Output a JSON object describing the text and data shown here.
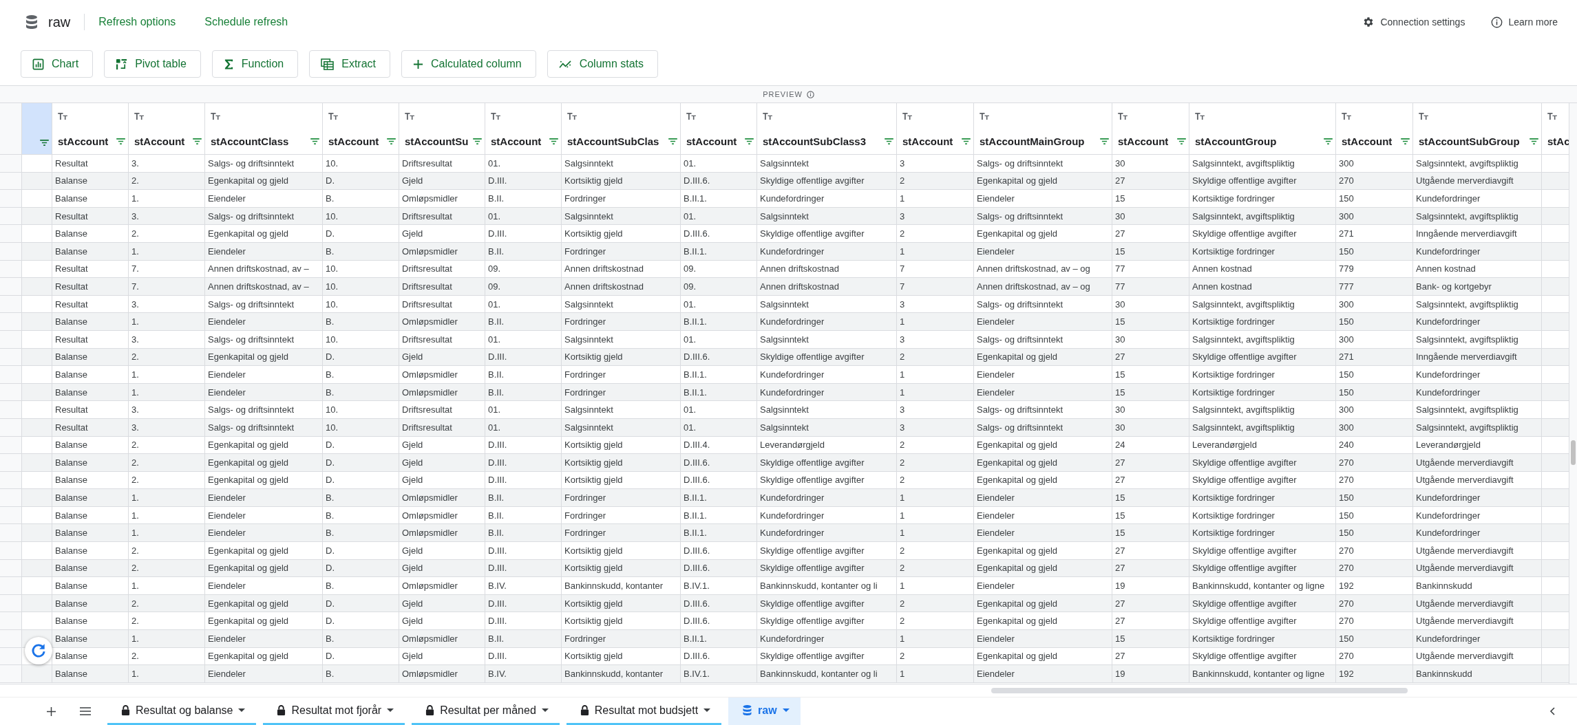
{
  "source": {
    "name": "raw"
  },
  "top_links": [
    "Refresh options",
    "Schedule refresh"
  ],
  "top_actions": [
    {
      "label": "Connection settings",
      "kind": "settings"
    },
    {
      "label": "Learn more",
      "kind": "info"
    }
  ],
  "toolbar": [
    {
      "label": "Chart",
      "kind": "chart"
    },
    {
      "label": "Pivot table",
      "kind": "pivot"
    },
    {
      "label": "Function",
      "kind": "function"
    },
    {
      "label": "Extract",
      "kind": "extract"
    },
    {
      "label": "Calculated column",
      "kind": "add"
    },
    {
      "label": "Column stats",
      "kind": "stats"
    }
  ],
  "preview_label": "PREVIEW",
  "table": {
    "columns": [
      "stAccount",
      "stAccount",
      "stAccountClass",
      "stAccount",
      "stAccountSu",
      "stAccount",
      "stAccountSubClas",
      "stAccount",
      "stAccountSubClass3",
      "stAccount",
      "stAccountMainGroup",
      "stAccount",
      "stAccountGroup",
      "stAccount",
      "stAccountSubGroup",
      "stAc"
    ],
    "rows": [
      [
        "Resultat",
        "3.",
        "Salgs- og driftsinntekt",
        "10.",
        "Driftsresultat",
        "01.",
        "Salgsinntekt",
        "01.",
        "Salgsinntekt",
        "3",
        "Salgs- og driftsinntekt",
        "30",
        "Salgsinntekt, avgiftspliktig",
        "300",
        "Salgsinntekt, avgiftspliktig"
      ],
      [
        "Balanse",
        "2.",
        "Egenkapital og gjeld",
        "D.",
        "Gjeld",
        "D.III.",
        "Kortsiktig gjeld",
        "D.III.6.",
        "Skyldige offentlige avgifter",
        "2",
        "Egenkapital og gjeld",
        "27",
        "Skyldige offentlige avgifter",
        "270",
        "Utgående merverdiavgift"
      ],
      [
        "Balanse",
        "1.",
        "Eiendeler",
        "B.",
        "Omløpsmidler",
        "B.II.",
        "Fordringer",
        "B.II.1.",
        "Kundefordringer",
        "1",
        "Eiendeler",
        "15",
        "Kortsiktige fordringer",
        "150",
        "Kundefordringer"
      ],
      [
        "Resultat",
        "3.",
        "Salgs- og driftsinntekt",
        "10.",
        "Driftsresultat",
        "01.",
        "Salgsinntekt",
        "01.",
        "Salgsinntekt",
        "3",
        "Salgs- og driftsinntekt",
        "30",
        "Salgsinntekt, avgiftspliktig",
        "300",
        "Salgsinntekt, avgiftspliktig"
      ],
      [
        "Balanse",
        "2.",
        "Egenkapital og gjeld",
        "D.",
        "Gjeld",
        "D.III.",
        "Kortsiktig gjeld",
        "D.III.6.",
        "Skyldige offentlige avgifter",
        "2",
        "Egenkapital og gjeld",
        "27",
        "Skyldige offentlige avgifter",
        "271",
        "Inngående merverdiavgift"
      ],
      [
        "Balanse",
        "1.",
        "Eiendeler",
        "B.",
        "Omløpsmidler",
        "B.II.",
        "Fordringer",
        "B.II.1.",
        "Kundefordringer",
        "1",
        "Eiendeler",
        "15",
        "Kortsiktige fordringer",
        "150",
        "Kundefordringer"
      ],
      [
        "Resultat",
        "7.",
        "Annen driftskostnad, av –",
        "10.",
        "Driftsresultat",
        "09.",
        "Annen driftskostnad",
        "09.",
        "Annen driftskostnad",
        "7",
        "Annen driftskostnad, av – og",
        "77",
        "Annen kostnad",
        "779",
        "Annen kostnad"
      ],
      [
        "Resultat",
        "7.",
        "Annen driftskostnad, av –",
        "10.",
        "Driftsresultat",
        "09.",
        "Annen driftskostnad",
        "09.",
        "Annen driftskostnad",
        "7",
        "Annen driftskostnad, av – og",
        "77",
        "Annen kostnad",
        "777",
        "Bank- og kortgebyr"
      ],
      [
        "Resultat",
        "3.",
        "Salgs- og driftsinntekt",
        "10.",
        "Driftsresultat",
        "01.",
        "Salgsinntekt",
        "01.",
        "Salgsinntekt",
        "3",
        "Salgs- og driftsinntekt",
        "30",
        "Salgsinntekt, avgiftspliktig",
        "300",
        "Salgsinntekt, avgiftspliktig"
      ],
      [
        "Balanse",
        "1.",
        "Eiendeler",
        "B.",
        "Omløpsmidler",
        "B.II.",
        "Fordringer",
        "B.II.1.",
        "Kundefordringer",
        "1",
        "Eiendeler",
        "15",
        "Kortsiktige fordringer",
        "150",
        "Kundefordringer"
      ],
      [
        "Resultat",
        "3.",
        "Salgs- og driftsinntekt",
        "10.",
        "Driftsresultat",
        "01.",
        "Salgsinntekt",
        "01.",
        "Salgsinntekt",
        "3",
        "Salgs- og driftsinntekt",
        "30",
        "Salgsinntekt, avgiftspliktig",
        "300",
        "Salgsinntekt, avgiftspliktig"
      ],
      [
        "Balanse",
        "2.",
        "Egenkapital og gjeld",
        "D.",
        "Gjeld",
        "D.III.",
        "Kortsiktig gjeld",
        "D.III.6.",
        "Skyldige offentlige avgifter",
        "2",
        "Egenkapital og gjeld",
        "27",
        "Skyldige offentlige avgifter",
        "271",
        "Inngående merverdiavgift"
      ],
      [
        "Balanse",
        "1.",
        "Eiendeler",
        "B.",
        "Omløpsmidler",
        "B.II.",
        "Fordringer",
        "B.II.1.",
        "Kundefordringer",
        "1",
        "Eiendeler",
        "15",
        "Kortsiktige fordringer",
        "150",
        "Kundefordringer"
      ],
      [
        "Balanse",
        "1.",
        "Eiendeler",
        "B.",
        "Omløpsmidler",
        "B.II.",
        "Fordringer",
        "B.II.1.",
        "Kundefordringer",
        "1",
        "Eiendeler",
        "15",
        "Kortsiktige fordringer",
        "150",
        "Kundefordringer"
      ],
      [
        "Resultat",
        "3.",
        "Salgs- og driftsinntekt",
        "10.",
        "Driftsresultat",
        "01.",
        "Salgsinntekt",
        "01.",
        "Salgsinntekt",
        "3",
        "Salgs- og driftsinntekt",
        "30",
        "Salgsinntekt, avgiftspliktig",
        "300",
        "Salgsinntekt, avgiftspliktig"
      ],
      [
        "Resultat",
        "3.",
        "Salgs- og driftsinntekt",
        "10.",
        "Driftsresultat",
        "01.",
        "Salgsinntekt",
        "01.",
        "Salgsinntekt",
        "3",
        "Salgs- og driftsinntekt",
        "30",
        "Salgsinntekt, avgiftspliktig",
        "300",
        "Salgsinntekt, avgiftspliktig"
      ],
      [
        "Balanse",
        "2.",
        "Egenkapital og gjeld",
        "D.",
        "Gjeld",
        "D.III.",
        "Kortsiktig gjeld",
        "D.III.4.",
        "Leverandørgjeld",
        "2",
        "Egenkapital og gjeld",
        "24",
        "Leverandørgjeld",
        "240",
        "Leverandørgjeld"
      ],
      [
        "Balanse",
        "2.",
        "Egenkapital og gjeld",
        "D.",
        "Gjeld",
        "D.III.",
        "Kortsiktig gjeld",
        "D.III.6.",
        "Skyldige offentlige avgifter",
        "2",
        "Egenkapital og gjeld",
        "27",
        "Skyldige offentlige avgifter",
        "270",
        "Utgående merverdiavgift"
      ],
      [
        "Balanse",
        "2.",
        "Egenkapital og gjeld",
        "D.",
        "Gjeld",
        "D.III.",
        "Kortsiktig gjeld",
        "D.III.6.",
        "Skyldige offentlige avgifter",
        "2",
        "Egenkapital og gjeld",
        "27",
        "Skyldige offentlige avgifter",
        "270",
        "Utgående merverdiavgift"
      ],
      [
        "Balanse",
        "1.",
        "Eiendeler",
        "B.",
        "Omløpsmidler",
        "B.II.",
        "Fordringer",
        "B.II.1.",
        "Kundefordringer",
        "1",
        "Eiendeler",
        "15",
        "Kortsiktige fordringer",
        "150",
        "Kundefordringer"
      ],
      [
        "Balanse",
        "1.",
        "Eiendeler",
        "B.",
        "Omløpsmidler",
        "B.II.",
        "Fordringer",
        "B.II.1.",
        "Kundefordringer",
        "1",
        "Eiendeler",
        "15",
        "Kortsiktige fordringer",
        "150",
        "Kundefordringer"
      ],
      [
        "Balanse",
        "1.",
        "Eiendeler",
        "B.",
        "Omløpsmidler",
        "B.II.",
        "Fordringer",
        "B.II.1.",
        "Kundefordringer",
        "1",
        "Eiendeler",
        "15",
        "Kortsiktige fordringer",
        "150",
        "Kundefordringer"
      ],
      [
        "Balanse",
        "2.",
        "Egenkapital og gjeld",
        "D.",
        "Gjeld",
        "D.III.",
        "Kortsiktig gjeld",
        "D.III.6.",
        "Skyldige offentlige avgifter",
        "2",
        "Egenkapital og gjeld",
        "27",
        "Skyldige offentlige avgifter",
        "270",
        "Utgående merverdiavgift"
      ],
      [
        "Balanse",
        "2.",
        "Egenkapital og gjeld",
        "D.",
        "Gjeld",
        "D.III.",
        "Kortsiktig gjeld",
        "D.III.6.",
        "Skyldige offentlige avgifter",
        "2",
        "Egenkapital og gjeld",
        "27",
        "Skyldige offentlige avgifter",
        "270",
        "Utgående merverdiavgift"
      ],
      [
        "Balanse",
        "1.",
        "Eiendeler",
        "B.",
        "Omløpsmidler",
        "B.IV.",
        "Bankinnskudd, kontanter",
        "B.IV.1.",
        "Bankinnskudd, kontanter og li",
        "1",
        "Eiendeler",
        "19",
        "Bankinnskudd, kontanter og ligne",
        "192",
        "Bankinnskudd"
      ],
      [
        "Balanse",
        "2.",
        "Egenkapital og gjeld",
        "D.",
        "Gjeld",
        "D.III.",
        "Kortsiktig gjeld",
        "D.III.6.",
        "Skyldige offentlige avgifter",
        "2",
        "Egenkapital og gjeld",
        "27",
        "Skyldige offentlige avgifter",
        "270",
        "Utgående merverdiavgift"
      ],
      [
        "Balanse",
        "2.",
        "Egenkapital og gjeld",
        "D.",
        "Gjeld",
        "D.III.",
        "Kortsiktig gjeld",
        "D.III.6.",
        "Skyldige offentlige avgifter",
        "2",
        "Egenkapital og gjeld",
        "27",
        "Skyldige offentlige avgifter",
        "270",
        "Utgående merverdiavgift"
      ],
      [
        "Balanse",
        "1.",
        "Eiendeler",
        "B.",
        "Omløpsmidler",
        "B.II.",
        "Fordringer",
        "B.II.1.",
        "Kundefordringer",
        "1",
        "Eiendeler",
        "15",
        "Kortsiktige fordringer",
        "150",
        "Kundefordringer"
      ],
      [
        "Balanse",
        "2.",
        "Egenkapital og gjeld",
        "D.",
        "Gjeld",
        "D.III.",
        "Kortsiktig gjeld",
        "D.III.6.",
        "Skyldige offentlige avgifter",
        "2",
        "Egenkapital og gjeld",
        "27",
        "Skyldige offentlige avgifter",
        "270",
        "Utgående merverdiavgift"
      ],
      [
        "Balanse",
        "1.",
        "Eiendeler",
        "B.",
        "Omløpsmidler",
        "B.IV.",
        "Bankinnskudd, kontanter",
        "B.IV.1.",
        "Bankinnskudd, kontanter og li",
        "1",
        "Eiendeler",
        "19",
        "Bankinnskudd, kontanter og ligne",
        "192",
        "Bankinnskudd"
      ]
    ]
  },
  "sheet_tabs": [
    {
      "label": "Resultat og balanse",
      "kind": "locked",
      "selected": false
    },
    {
      "label": "Resultat mot fjorår",
      "kind": "locked",
      "selected": false
    },
    {
      "label": "Resultat per måned",
      "kind": "locked",
      "selected": false
    },
    {
      "label": "Resultat mot budsjett",
      "kind": "locked",
      "selected": false
    },
    {
      "label": "raw",
      "kind": "source",
      "selected": true
    }
  ]
}
